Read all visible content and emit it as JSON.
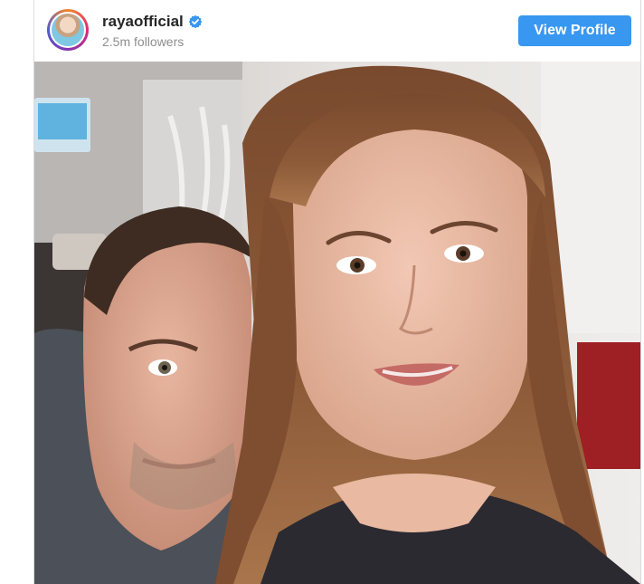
{
  "profile": {
    "username": "rayaofficial",
    "followers": "2.5m followers",
    "verified_icon": "verified-badge-icon",
    "view_profile_label": "View Profile"
  },
  "post": {
    "image_label": "selfie-photo"
  },
  "colors": {
    "accent": "#3897f0",
    "username_text": "#262626",
    "muted_text": "#8e8e8e"
  }
}
